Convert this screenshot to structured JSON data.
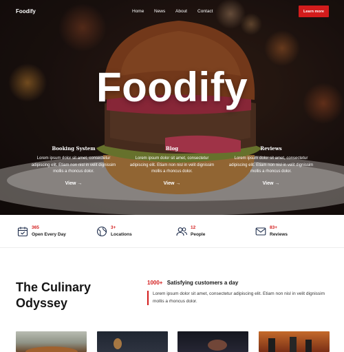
{
  "nav": {
    "brand": "Foodify",
    "links": [
      "Home",
      "News",
      "About",
      "Contact"
    ],
    "cta_label": "Learn more"
  },
  "hero": {
    "title": "Foodify",
    "features": [
      {
        "title": "Booking System",
        "text": "Lorem ipsum dolor sit amet, consectetur adipiscing elit. Etiam non nisl in velit dignissim mollis a rhoncus dolor.",
        "link": "View →"
      },
      {
        "title": "Blog",
        "text": "Lorem ipsum dolor sit amet, consectetur adipiscing elit. Etiam non nisl in velit dignissim mollis a rhoncus dolor.",
        "link": "View →"
      },
      {
        "title": "Reviews",
        "text": "Lorem ipsum dolor sit amet, consectetur adipiscing elit. Etiam non nisl in velit dignissim mollis a rhoncus dolor.",
        "link": "View →"
      }
    ]
  },
  "stats": [
    {
      "value": "365",
      "label": "Open Every Day",
      "icon": "calendar-icon"
    },
    {
      "value": "3+",
      "label": "Locations",
      "icon": "globe-icon"
    },
    {
      "value": "12",
      "label": "People",
      "icon": "users-icon"
    },
    {
      "value": "83+",
      "label": "Reviews",
      "icon": "mail-icon"
    }
  ],
  "odyssey": {
    "title": "The Culinary Odyssey",
    "stat_value": "1000+",
    "stat_text": "Satisfying customers a day",
    "quote": "Lorem ipsum dolor sit amet, consectetur adipiscing elit. Etiam non nisl in velit dignissim mollis a rhoncus dolor."
  },
  "colors": {
    "accent": "#d31c1c",
    "text": "#151515"
  }
}
